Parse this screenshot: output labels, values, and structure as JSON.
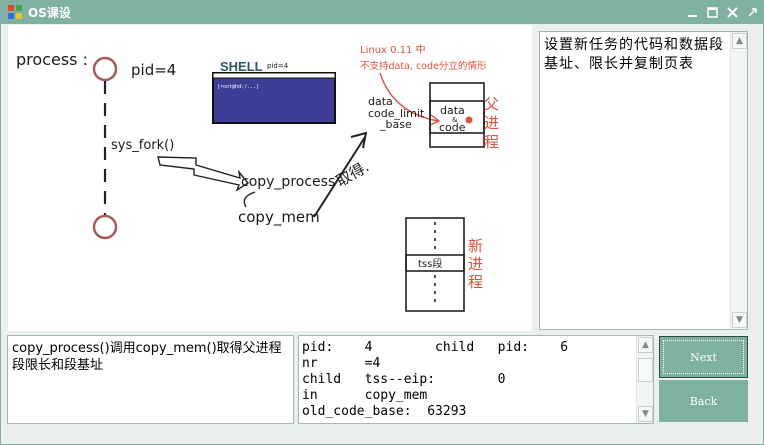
{
  "window": {
    "title": "OS课设"
  },
  "diagram": {
    "process_label": "process :",
    "pid_label": "pid=4",
    "shell_title": "SHELL",
    "shell_pid": "pid=4",
    "shell_line": "[root@hd:/...]",
    "sys_fork": "sys_fork()",
    "copy_process": "copy_process",
    "copy_mem": "copy_mem",
    "obtain": "取得.",
    "red_note_line1": "Linux 0.11 中",
    "red_note_line2": "不支持data, code分立的情形",
    "data_code_limit_line1": "data",
    "data_code_limit_line2": "code_limit",
    "data_code_limit_line3": "_base",
    "box_data": "data",
    "box_amp": "&",
    "box_code": "code",
    "parent_label": [
      "父",
      "进",
      "程"
    ],
    "tss_label": "tss段",
    "new_label": [
      "新",
      "进",
      "程"
    ]
  },
  "description_box": {
    "text": "设置新任务的代码和数据段基址、限长并复制页表"
  },
  "explain_box": {
    "text": "copy_process()调用copy_mem()取得父进程段限长和段基址"
  },
  "info_box": {
    "lines": [
      "pid:    4        child   pid:    6",
      "nr      =4",
      "child   tss--eip:        0",
      "in      copy_mem",
      "old_code_base:  63293"
    ]
  },
  "buttons": {
    "next": "Next",
    "back": "Back"
  },
  "colors": {
    "accent": "#7fb1a3",
    "node_ring": "#a85a56",
    "annotation_red": "#e0503c",
    "shell_screen": "#3d3d96"
  }
}
